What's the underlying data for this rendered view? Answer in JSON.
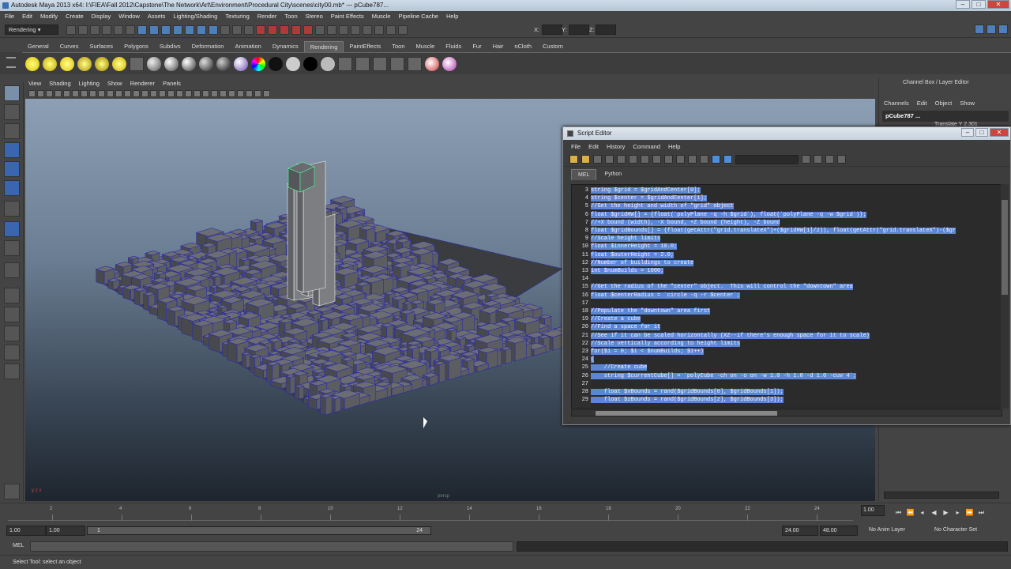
{
  "window": {
    "title": "Autodesk Maya 2013 x64: I:\\FIEA\\Fall 2012\\Capstone\\The Network\\Art\\Environment\\Procedural City\\scenes\\city00.mb*   ---   pCube787..."
  },
  "menubar": [
    "File",
    "Edit",
    "Modify",
    "Create",
    "Display",
    "Window",
    "Assets",
    "Lighting/Shading",
    "Texturing",
    "Render",
    "Toon",
    "Stereo",
    "Paint Effects",
    "Muscle",
    "Pipeline Cache",
    "Help"
  ],
  "status": {
    "mode": "Rendering",
    "x_label": "X:",
    "y_label": "Y:",
    "z_label": "Z:"
  },
  "shelf_tabs": [
    "General",
    "Curves",
    "Surfaces",
    "Polygons",
    "Subdivs",
    "Deformation",
    "Animation",
    "Dynamics",
    "Rendering",
    "PaintEffects",
    "Toon",
    "Muscle",
    "Fluids",
    "Fur",
    "Hair",
    "nCloth",
    "Custom"
  ],
  "shelf_active": "Rendering",
  "viewport": {
    "menu": [
      "View",
      "Shading",
      "Lighting",
      "Show",
      "Renderer",
      "Panels"
    ],
    "camera_label": "persp",
    "axis_label": "y z x"
  },
  "channel_box": {
    "title": "Channel Box / Layer Editor",
    "menu": [
      "Channels",
      "Edit",
      "Object",
      "Show"
    ],
    "object": "pCube787 ...",
    "attr_partial": "Translate Y  2.301"
  },
  "script_editor": {
    "title": "Script Editor",
    "menu": [
      "File",
      "Edit",
      "History",
      "Command",
      "Help"
    ],
    "tabs": [
      "MEL",
      "Python"
    ],
    "active_tab": "MEL",
    "lines": [
      {
        "n": "3",
        "t": "string $grid = $gridAndCenter[0];"
      },
      {
        "n": "4",
        "t": "string $center = $gridAndCenter[1];"
      },
      {
        "n": "5",
        "t": "//Get the height and width of \"grid\" object"
      },
      {
        "n": "6",
        "t": "float $gridHW[] = {float(`polyPlane -q -h $grid`), float(`polyPlane -q -w $grid`)};"
      },
      {
        "n": "7",
        "t": "//+X bound (width), -X bound, +Z bound (height), -Z bound"
      },
      {
        "n": "8",
        "t": "float $gridBounds[] = {float(getAttr(\"grid.translateX\")+($gridHW[1]/2)), float(getAttr(\"grid.translateX\")-($gr"
      },
      {
        "n": "9",
        "t": "//Scale height limits"
      },
      {
        "n": "10",
        "t": "float $innerHeight = 10.0;"
      },
      {
        "n": "11",
        "t": "float $outerHeight = 2.0;"
      },
      {
        "n": "12",
        "t": "//Number of buildings to create"
      },
      {
        "n": "13",
        "t": "int $numBuilds = 1000;"
      },
      {
        "n": "14",
        "t": ""
      },
      {
        "n": "15",
        "t": "//Get the radius of the \"center\" object.  This will control the \"downtown\" area"
      },
      {
        "n": "16",
        "t": "float $centerRadius = `circle -q -r $center`;"
      },
      {
        "n": "17",
        "t": ""
      },
      {
        "n": "18",
        "t": "//Populate the \"downtown\" area first"
      },
      {
        "n": "19",
        "t": "//Create a cube"
      },
      {
        "n": "20",
        "t": "//Find a space for it"
      },
      {
        "n": "21",
        "t": "//See if it can be scaled horizontally (XZ--if there's enough space for it to scale)"
      },
      {
        "n": "22",
        "t": "//Scale vertically according to height limits"
      },
      {
        "n": "23",
        "t": "for($i = 0; $i < $numBuilds; $i++)"
      },
      {
        "n": "24",
        "t": "{"
      },
      {
        "n": "25",
        "t": "    //Create cube"
      },
      {
        "n": "26",
        "t": "    string $currentCube[] = `polyCube -ch on -o on -w 1.0 -h 1.0 -d 1.0 -cuv 4`;"
      },
      {
        "n": "27",
        "t": ""
      },
      {
        "n": "28",
        "t": "    float $xBounds = rand($gridBounds[0], $gridBounds[1]);"
      },
      {
        "n": "29",
        "t": "    float $zBounds = rand($gridBounds[2], $gridBounds[3]);"
      }
    ]
  },
  "timeline": {
    "ticks": [
      "2",
      "4",
      "6",
      "8",
      "10",
      "12",
      "14",
      "16",
      "18",
      "20",
      "22",
      "24"
    ],
    "current": "1.00"
  },
  "range": {
    "start": "1.00",
    "inner_start": "1.00",
    "slider_start": "1",
    "slider_end": "24",
    "end": "24.00",
    "outer_end": "48.00",
    "anim_layer": "No Anim Layer",
    "char_set": "No Character Set"
  },
  "command": {
    "label": "MEL"
  },
  "help_line": "Select Tool: select an object",
  "colors": {
    "selection": "#5b86d6",
    "viewport_top": "#8c9fb4",
    "viewport_bottom": "#1e252e",
    "wire": "#2b2ba8",
    "selected_wire": "#4dff9a"
  }
}
